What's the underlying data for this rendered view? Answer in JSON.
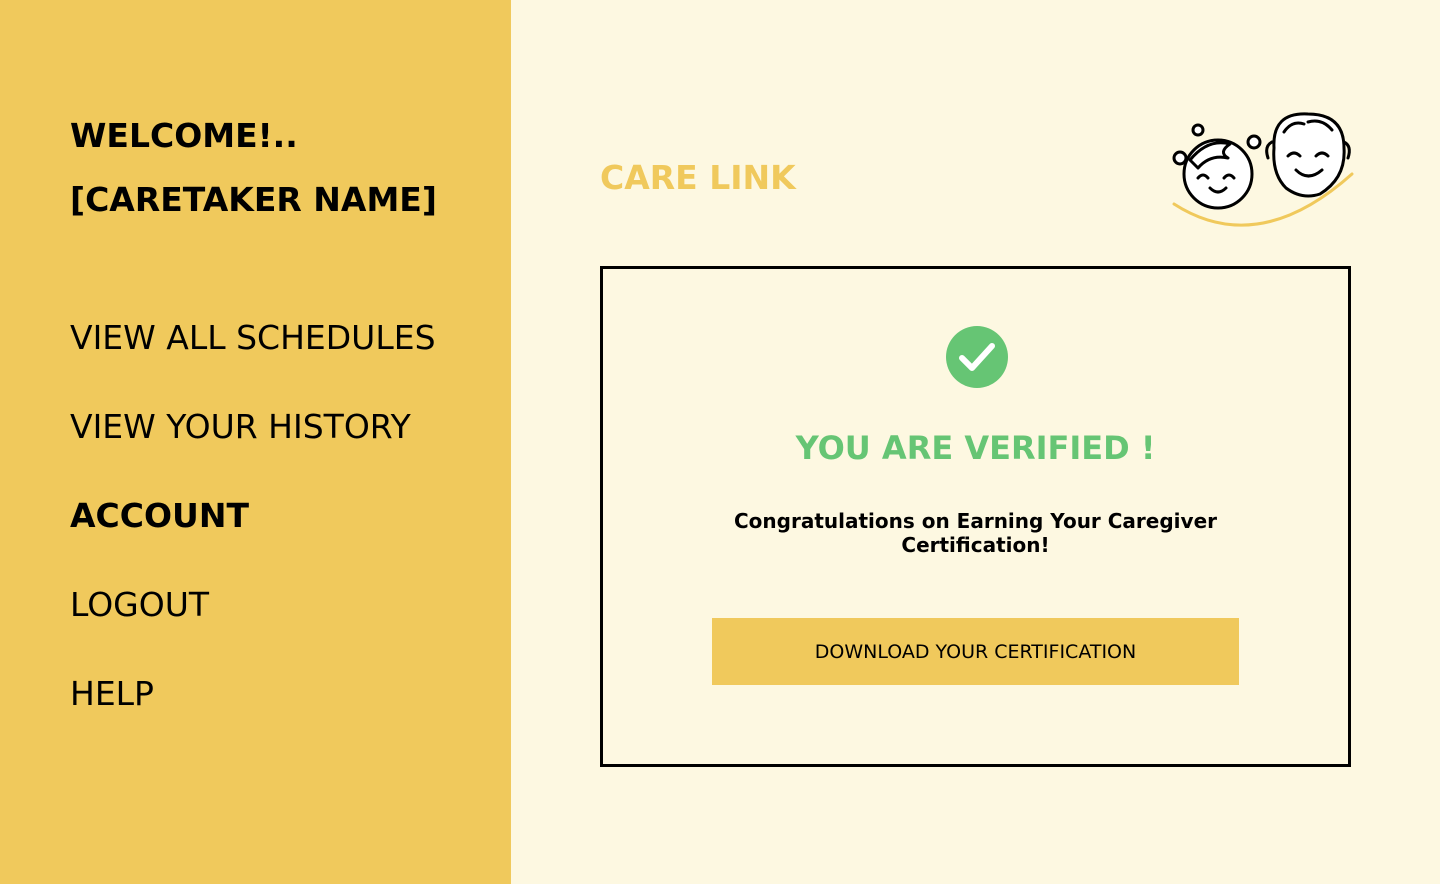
{
  "colors": {
    "sidebar_bg": "#f0c95c",
    "main_bg": "#fdf8e1",
    "brand": "#f0c95c",
    "verified_green": "#66c574",
    "button_bg": "#f0c95c",
    "text": "#000000"
  },
  "sidebar": {
    "welcome": "WELCOME!..",
    "caretaker_name": "[CARETAKER NAME]",
    "items": [
      {
        "label": "VIEW ALL SCHEDULES",
        "active": false
      },
      {
        "label": "VIEW YOUR HISTORY",
        "active": false
      },
      {
        "label": "ACCOUNT",
        "active": true
      },
      {
        "label": "LOGOUT",
        "active": false
      },
      {
        "label": "HELP",
        "active": false
      }
    ]
  },
  "header": {
    "brand": "CARE LINK",
    "logo_icon": "child-and-grandparent-faces-icon"
  },
  "card": {
    "status_icon": "check-circle-icon",
    "title": "YOU ARE VERIFIED !",
    "message_line1": "Congratulations on Earning Your Caregiver",
    "message_line2": "Certification!",
    "button_label": "DOWNLOAD YOUR CERTIFICATION"
  }
}
